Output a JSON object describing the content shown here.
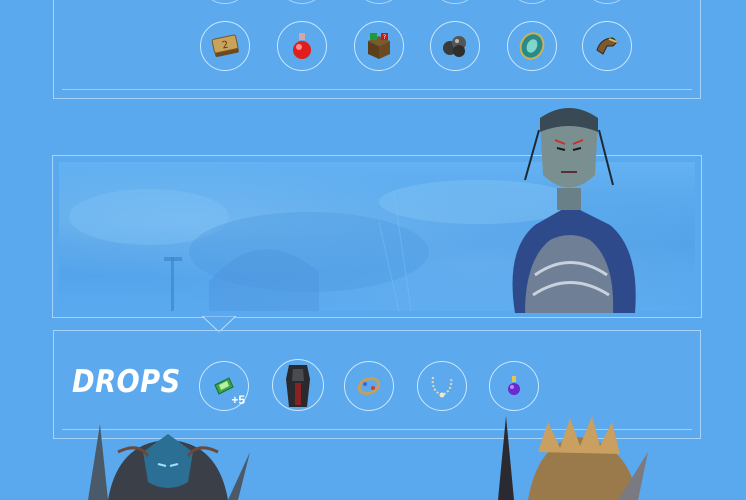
{
  "top_row": {
    "items": [
      {
        "icon": "book-icon"
      },
      {
        "icon": "potion-icon"
      },
      {
        "icon": "mystery-box-icon"
      },
      {
        "icon": "ore-icon"
      },
      {
        "icon": "seal-icon"
      },
      {
        "icon": "gauntlet-icon"
      }
    ]
  },
  "drops": {
    "title": "DROPS",
    "items": [
      {
        "icon": "gem-icon",
        "badge": "+5"
      },
      {
        "icon": "armor-icon"
      },
      {
        "icon": "bracelet-icon"
      },
      {
        "icon": "necklace-icon"
      },
      {
        "icon": "elixir-icon"
      }
    ]
  },
  "colors": {
    "background": "#5aa8ee",
    "border": "#bee1ff",
    "text": "#ffffff"
  }
}
